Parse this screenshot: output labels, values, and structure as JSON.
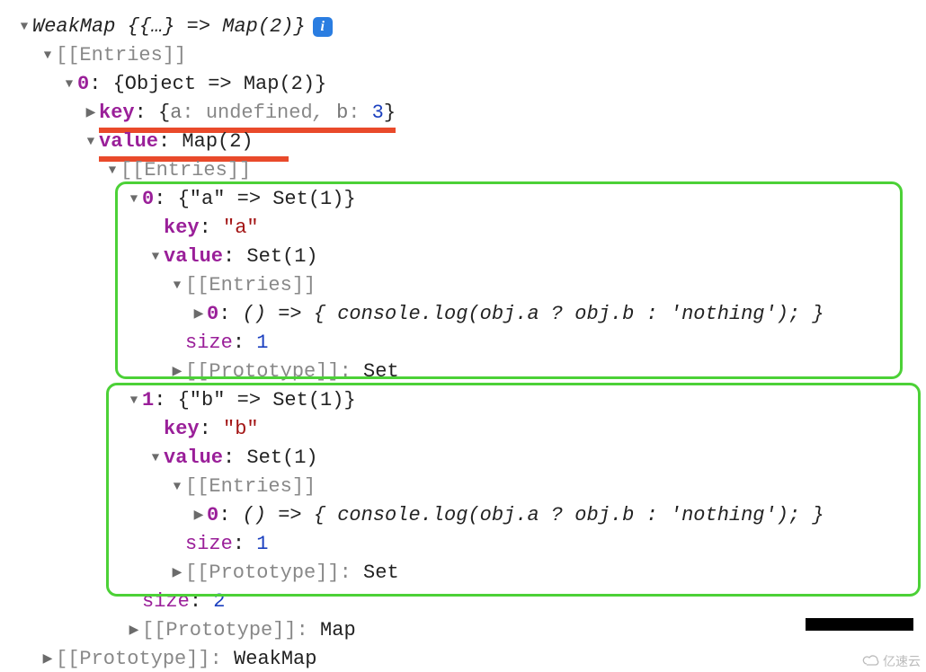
{
  "root": {
    "label_pre": "WeakMap {",
    "label_mid": "{…}",
    "label_arrow": " => ",
    "label_map": "Map(2)",
    "label_end": "}"
  },
  "entries_label": "[[Entries]]",
  "prototype_label": "[[Prototype]]",
  "colon": ": ",
  "undefined": "undefined",
  "map2": "Map(2)",
  "set_type": "Set",
  "map_type": "Map",
  "weakmap_type": "WeakMap",
  "entry0": {
    "idx": "0",
    "desc_l": "{Object => Map(2)}",
    "key_label": "key",
    "key_open": "{",
    "key_a": "a",
    "key_b": "b",
    "key_b_val": "3",
    "key_close": "}",
    "comma": ", ",
    "value_label": "value",
    "value_map": "Map(2)"
  },
  "map_entry_a": {
    "idx": "0",
    "desc": "{\"a\" => Set(1)}",
    "key_label": "key",
    "key_val": "\"a\"",
    "value_label": "value",
    "set1": "Set(1)",
    "fn_idx": "0",
    "fn_body": "() => { console.log(obj.a ? obj.b : 'nothing'); }",
    "size_label": "size",
    "size_val": "1",
    "proto_val": "Set"
  },
  "map_entry_b": {
    "idx": "1",
    "desc": "{\"b\" => Set(1)}",
    "key_label": "key",
    "key_val": "\"b\"",
    "value_label": "value",
    "set1": "Set(1)",
    "fn_idx": "0",
    "fn_body": "() => { console.log(obj.a ? obj.b : 'nothing'); }",
    "size_label": "size",
    "size_val": "1",
    "proto_val": "Set"
  },
  "outer_size_label": "size",
  "outer_size_val": "2",
  "watermark": "亿速云"
}
